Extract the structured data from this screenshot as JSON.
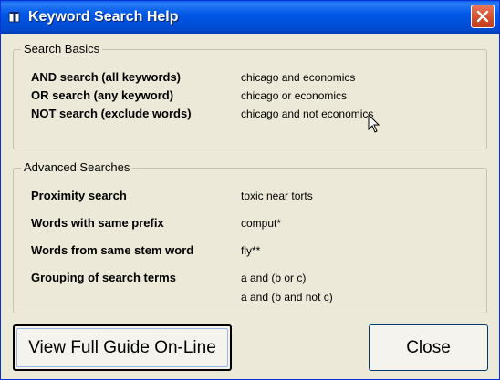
{
  "window": {
    "title": "Keyword Search Help"
  },
  "basics": {
    "legend": "Search Basics",
    "rows": [
      {
        "label": "AND search (all keywords)",
        "example": "chicago and economics"
      },
      {
        "label": "OR search (any keyword)",
        "example": "chicago or economics"
      },
      {
        "label": "NOT search (exclude words)",
        "example": "chicago and not economics"
      }
    ]
  },
  "advanced": {
    "legend": "Advanced Searches",
    "rows": [
      {
        "label": "Proximity search",
        "example": "toxic near torts"
      },
      {
        "label": "Words with same prefix",
        "example": "comput*"
      },
      {
        "label": "Words from same stem word",
        "example": "fly**"
      },
      {
        "label": "Grouping of search terms",
        "example": "a and (b or c)",
        "example2": "a and (b and not  c)"
      }
    ]
  },
  "buttons": {
    "view_guide": "View Full Guide On-Line",
    "close": "Close"
  },
  "icons": {
    "title_icon": "book-icon",
    "close_icon": "close-icon",
    "cursor": "mouse-cursor-icon"
  }
}
